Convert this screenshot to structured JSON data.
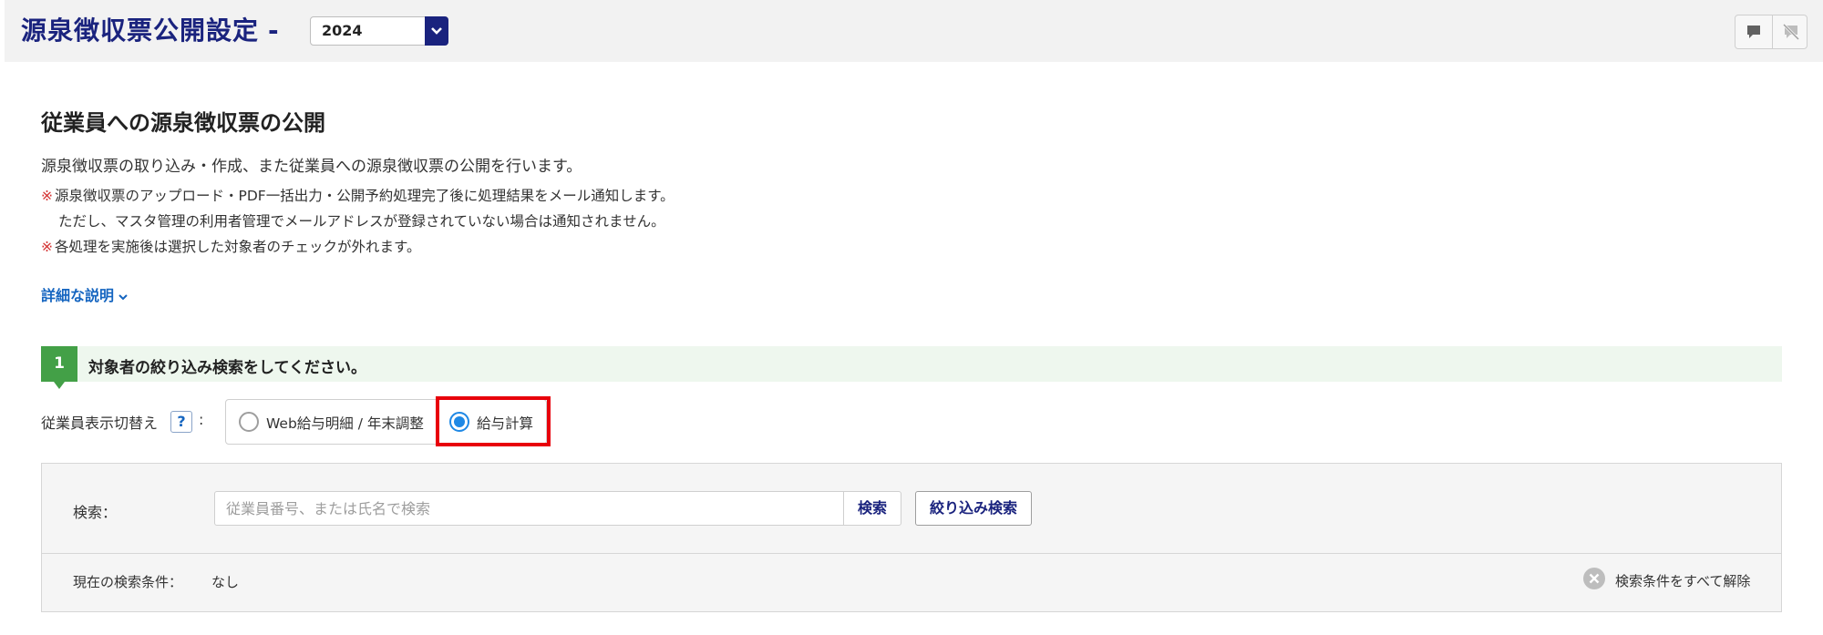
{
  "header": {
    "title": "源泉徴収票公開設定",
    "separator": "-",
    "year": "2024",
    "icons": [
      "comment-icon",
      "comment-off-icon"
    ]
  },
  "main": {
    "title": "従業員への源泉徴収票の公開",
    "description": "源泉徴収票の取り込み・作成、また従業員への源泉徴収票の公開を行います。",
    "notes": [
      {
        "mark": "※",
        "text": "源泉徴収票のアップロード・PDF一括出力・公開予約処理完了後に処理結果をメール通知します。"
      },
      {
        "mark": "",
        "text": "ただし、マスタ管理の利用者管理でメールアドレスが登録されていない場合は通知されません。"
      },
      {
        "mark": "※",
        "text": "各処理を実施後は選択した対象者のチェックが外れます。"
      }
    ],
    "detail_link": "詳細な説明"
  },
  "step1": {
    "number": "1",
    "text": "対象者の絞り込み検索をしてください。"
  },
  "employee_switch": {
    "label": "従業員表示切替え",
    "help": "?",
    "colon": ":",
    "options": [
      "Web給与明細 / 年末調整",
      "給与計算"
    ],
    "selected": "給与計算"
  },
  "search": {
    "label": "検索：",
    "placeholder": "従業員番号、または氏名で検索",
    "button": "検索",
    "filter_button": "絞り込み検索",
    "current_label": "現在の検索条件：",
    "current_value": "なし",
    "clear_all": "検索条件をすべて解除"
  },
  "colors": {
    "brand": "#1a237e",
    "step": "#43a047",
    "radio_selected": "#1e88e5",
    "highlight": "#e8000b",
    "link": "#1565c0"
  }
}
